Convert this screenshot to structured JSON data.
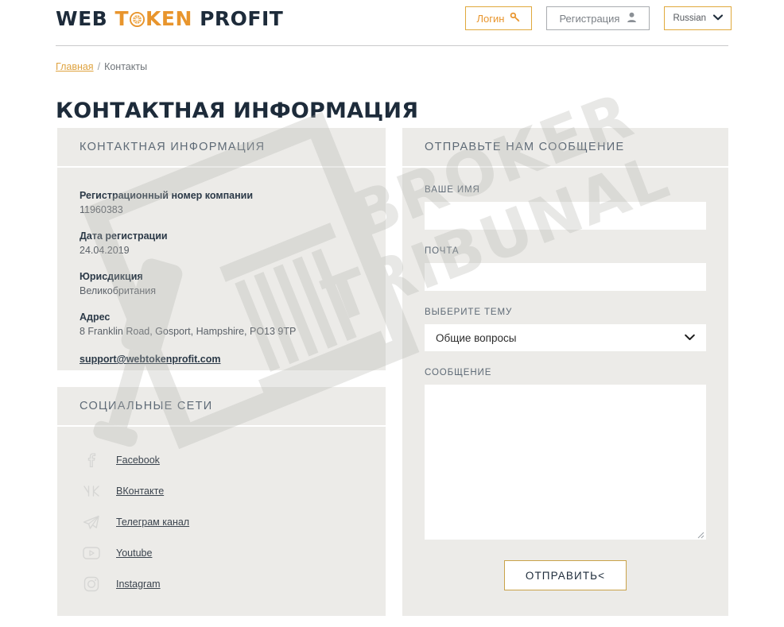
{
  "header": {
    "logo": {
      "part1": "WEB",
      "part2_pre": "T",
      "token_icon": "token-circle-icon",
      "part2_post": "KEN",
      "part3": "PROFIT"
    },
    "login_label": "Логин",
    "login_icon": "key-icon",
    "register_label": "Регистрация",
    "register_icon": "user-icon",
    "language_value": "Russian",
    "language_icon": "chevron-down-icon"
  },
  "breadcrumb": {
    "home": "Главная",
    "separator": "/",
    "current": "Контакты"
  },
  "page_title": "КОНТАКТНАЯ ИНФОРМАЦИЯ",
  "watermark": {
    "line1": "BROKER",
    "line2": "TRIBUNAL"
  },
  "contact_panel": {
    "heading": "КОНТАКТНАЯ ИНФОРМАЦИЯ",
    "fields": [
      {
        "label": "Регистрационный номер компании",
        "value": "11960383"
      },
      {
        "label": "Дата регистрации",
        "value": "24.04.2019"
      },
      {
        "label": "Юрисдикция",
        "value": "Великобритания"
      },
      {
        "label": "Адрес",
        "value": "8 Franklin Road, Gosport, Hampshire, PO13 9TP"
      }
    ],
    "email": "support@webtokenprofit.com"
  },
  "social_panel": {
    "heading": "СОЦИАЛЬНЫЕ СЕТИ",
    "items": [
      {
        "label": "Facebook",
        "icon": "facebook-icon"
      },
      {
        "label": "ВКонтакте",
        "icon": "vk-icon"
      },
      {
        "label": "Телеграм канал",
        "icon": "telegram-icon"
      },
      {
        "label": "Youtube",
        "icon": "youtube-icon"
      },
      {
        "label": "Instagram",
        "icon": "instagram-icon"
      }
    ]
  },
  "form_panel": {
    "heading": "ОТПРАВЬТЕ НАМ СООБЩЕНИЕ",
    "name_label": "ВАШЕ ИМЯ",
    "name_value": "",
    "email_label": "ПОЧТА",
    "email_value": "",
    "topic_label": "ВЫБЕРИТЕ ТЕМУ",
    "topic_value": "Общие вопросы",
    "message_label": "СООБЩЕНИЕ",
    "message_value": "",
    "submit_label": "ОТПРАВИТЬ<"
  },
  "colors": {
    "brand_orange": "#e8952d",
    "brand_dark": "#1d2b3a",
    "panel_bg": "#ecebe8",
    "gold_border": "#e0a93c",
    "heading_gray": "#5e6a76"
  }
}
